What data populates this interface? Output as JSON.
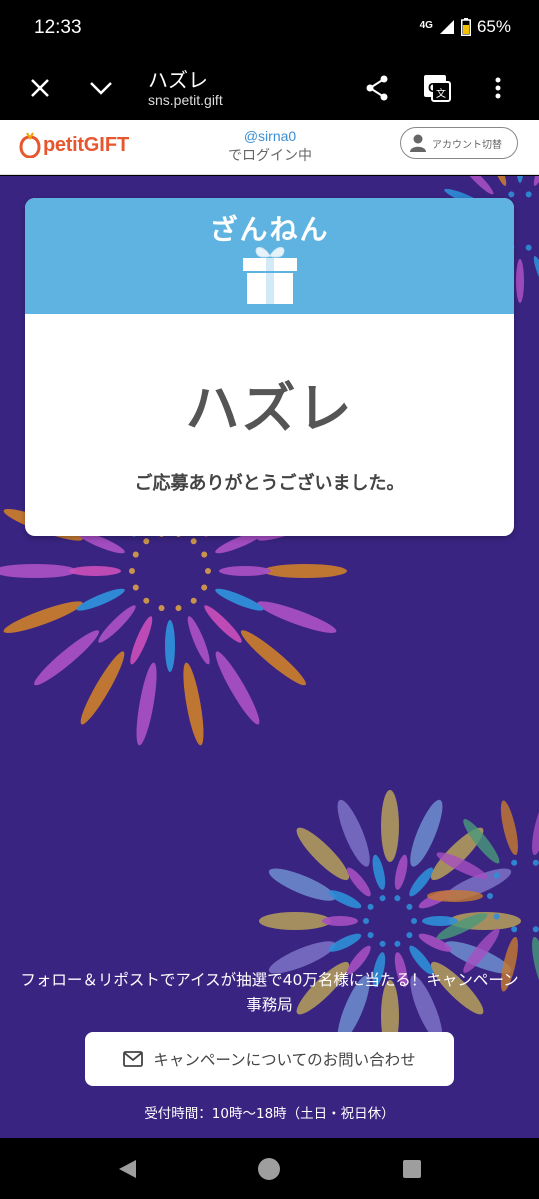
{
  "status_bar": {
    "time": "12:33",
    "network": "4G",
    "battery": "65%"
  },
  "browser": {
    "title": "ハズレ",
    "url": "sns.petit.gift"
  },
  "site_header": {
    "logo_petit": "petit",
    "logo_gift": "GIFT",
    "user": "@sirna0",
    "login_text": "でログイン中",
    "account_switch": "アカウント切替"
  },
  "result": {
    "banner": "ざんねん",
    "title": "ハズレ",
    "message": "ご応募ありがとうございました。"
  },
  "footer": {
    "organizer": "フォロー＆リポストでアイスが抽選で40万名様に当たる！キャンペーン事務局",
    "contact_label": "キャンペーンについてのお問い合わせ",
    "hours": "受付時間：10時〜18時（土日・祝日休）"
  },
  "colors": {
    "main_bg": "#392481",
    "card_header": "#5fb3e0",
    "brand": "#e8562e",
    "user_link": "#3a8fd6"
  }
}
